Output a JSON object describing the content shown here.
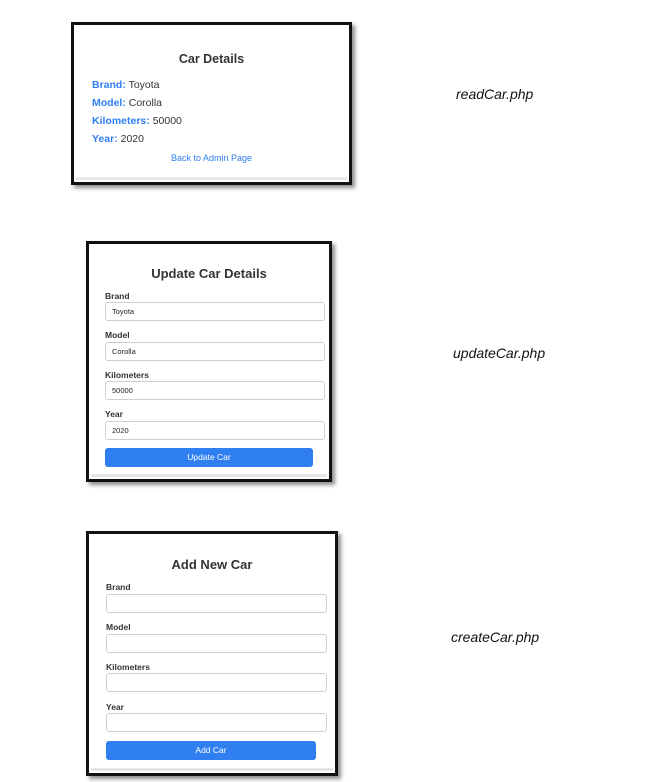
{
  "read": {
    "title": "Car Details",
    "fields": [
      {
        "key": "Brand:",
        "value": "Toyota"
      },
      {
        "key": "Model:",
        "value": "Corolla"
      },
      {
        "key": "Kilometers:",
        "value": "50000"
      },
      {
        "key": "Year:",
        "value": "2020"
      }
    ],
    "back_link": "Back to Admin Page",
    "caption": "readCar.php"
  },
  "update": {
    "title": "Update Car Details",
    "fields": [
      {
        "label": "Brand",
        "value": "Toyota"
      },
      {
        "label": "Model",
        "value": "Corolla"
      },
      {
        "label": "Kilometers",
        "value": "50000"
      },
      {
        "label": "Year",
        "value": "2020"
      }
    ],
    "button": "Update Car",
    "caption": "updateCar.php"
  },
  "create": {
    "title": "Add New Car",
    "fields": [
      {
        "label": "Brand",
        "value": ""
      },
      {
        "label": "Model",
        "value": ""
      },
      {
        "label": "Kilometers",
        "value": ""
      },
      {
        "label": "Year",
        "value": ""
      }
    ],
    "button": "Add Car",
    "caption": "createCar.php"
  },
  "colors": {
    "accent": "#2f7ff0",
    "border": "#111111"
  }
}
